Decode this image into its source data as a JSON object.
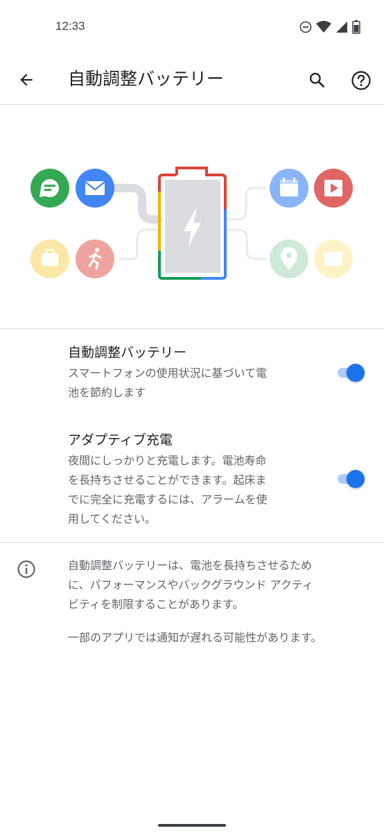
{
  "status_bar": {
    "time": "12:33",
    "icons": [
      "do-not-disturb-icon",
      "wifi-icon",
      "cell-signal-icon",
      "battery-icon"
    ]
  },
  "app_bar": {
    "title": "自動調整バッテリー",
    "icons": [
      "back-arrow-icon",
      "search-icon",
      "help-icon"
    ]
  },
  "illustration": {
    "colors": {
      "red": "#db4437",
      "yellow": "#f4b400",
      "green": "#0f9d58",
      "blue": "#4285f4"
    },
    "left_icons": [
      "message-icon",
      "mail-icon",
      "briefcase-icon",
      "running-person-icon"
    ],
    "right_icons": [
      "calendar-icon",
      "play-video-icon",
      "map-pin-icon",
      "folder-icon"
    ],
    "center_icon": "lightning-bolt-icon"
  },
  "settings": [
    {
      "title": "自動調整バッテリー",
      "summary": [
        "スマートフォンの使用状況に基づいて電",
        "池を節約します"
      ],
      "enabled": true
    },
    {
      "title": "アダプティブ充電",
      "summary": [
        "夜間にしっかりと充電します。電池寿命",
        "を長持ちさせることができます。起床ま",
        "でに完全に充電するには、アラームを使",
        "用してください。"
      ],
      "enabled": true
    }
  ],
  "info": {
    "icon": "info-icon",
    "paragraph1": [
      "自動調整バッテリーは、電池を長持ちさせるため",
      "に、パフォーマンスやバックグラウンド アクティ",
      "ビティを制限することがあります。"
    ],
    "paragraph2": "一部のアプリでは通知が遅れる可能性があります。"
  },
  "accent_color": "#1a73e8"
}
